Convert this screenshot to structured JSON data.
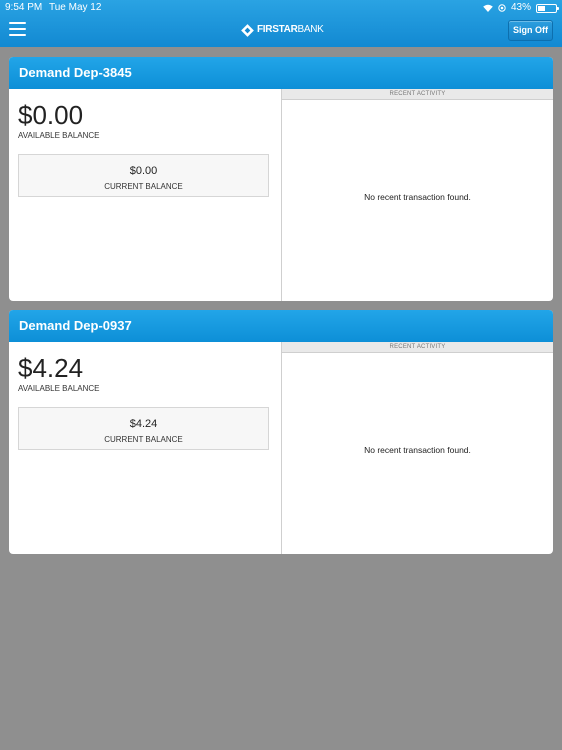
{
  "status": {
    "time": "9:54 PM",
    "date": "Tue May 12",
    "battery": "43%",
    "battery_level": 0.43
  },
  "header": {
    "brand_strong": "FIRSTAR",
    "brand_light": "BANK",
    "signoff_label": "Sign Off"
  },
  "accounts": [
    {
      "title": "Demand Dep-3845",
      "available_amount": "$0.00",
      "available_label": "AVAILABLE BALANCE",
      "current_amount": "$0.00",
      "current_label": "CURRENT BALANCE",
      "recent_header": "RECENT ACTIVITY",
      "recent_empty": "No recent transaction found."
    },
    {
      "title": "Demand Dep-0937",
      "available_amount": "$4.24",
      "available_label": "AVAILABLE BALANCE",
      "current_amount": "$4.24",
      "current_label": "CURRENT BALANCE",
      "recent_header": "RECENT ACTIVITY",
      "recent_empty": "No recent transaction found."
    }
  ],
  "colors": {
    "header": "#1289d2",
    "background": "#8f8f8f",
    "card_header": "#0d8fd7"
  },
  "icons": {
    "menu": "hamburger-icon",
    "wifi": "wifi-icon",
    "location": "location-icon",
    "battery": "battery-icon",
    "logo": "firstar-logo-icon"
  }
}
